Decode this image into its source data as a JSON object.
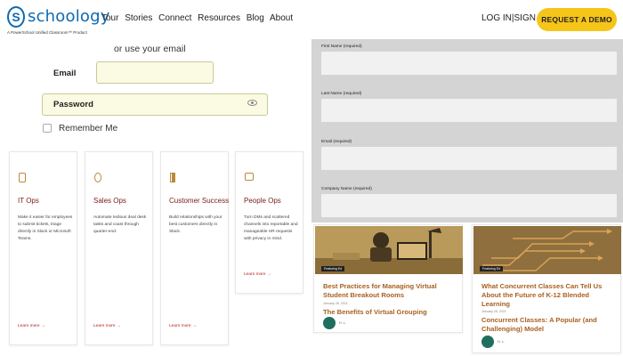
{
  "header": {
    "logo_letter": "S",
    "logo_word": "schoology",
    "logo_tagline": "A PowerSchool Unified Classroom™ Product",
    "nav": [
      "Tour",
      "Stories",
      "Connect",
      "Resources",
      "Blog",
      "About"
    ],
    "login": "LOG IN",
    "separator": "|",
    "signup": "SIGN UP",
    "demo_button": "REQUEST A DEMO"
  },
  "login_form": {
    "or_text": "or use your email",
    "email_label": "Email",
    "email_value": "",
    "password_label": "Password",
    "password_value": "",
    "remember_label": "Remember Me"
  },
  "cards": [
    {
      "icon": "ticket-icon",
      "title": "IT Ops",
      "desc": "Make it easier for employees to submit tickets, triage directly in Slack or Microsoft Teams.",
      "link": "Learn more →"
    },
    {
      "icon": "coin-icon",
      "title": "Sales Ops",
      "desc": "Automate tedious deal desk tasks and coast through quarter-end.",
      "link": "Learn more →"
    },
    {
      "icon": "flag-icon",
      "title": "Customer Success",
      "desc": "Build relationships with your best customers directly in Slack.",
      "link": "Learn more →"
    },
    {
      "icon": "people-icon",
      "title": "People Ops",
      "desc": "Turn DMs and scattered channels into reportable and manageable HR requests with privacy in mind.",
      "link": "Learn more →"
    }
  ],
  "form_panel": {
    "fields": [
      {
        "label": "First Name (required)",
        "value": ""
      },
      {
        "label": "Last Name (required)",
        "value": ""
      },
      {
        "label": "Email (required)",
        "value": ""
      },
      {
        "label": "Company Name (required)",
        "value": ""
      }
    ]
  },
  "blogs": [
    {
      "tag": "Featuring Ed",
      "title": "Best Practices for Managing Virtual Student Breakout Rooms",
      "date": "January 28, 2021",
      "subtitle": "The Benefits of Virtual Grouping",
      "author": "H. L."
    },
    {
      "tag": "Featuring Ed",
      "title": "What Concurrent Classes Can Tell Us About the Future of K-12 Blended Learning",
      "date": "January 26, 2021",
      "subtitle": "Concurrent Classes: A Popular (and Challenging) Model",
      "author": "H. L."
    }
  ],
  "colors": {
    "brand": "#0d6ab3",
    "accent": "#f6c519",
    "card_title": "#7a1a14",
    "blog_title": "#a95f1f",
    "panel": "#d4d4d4"
  }
}
